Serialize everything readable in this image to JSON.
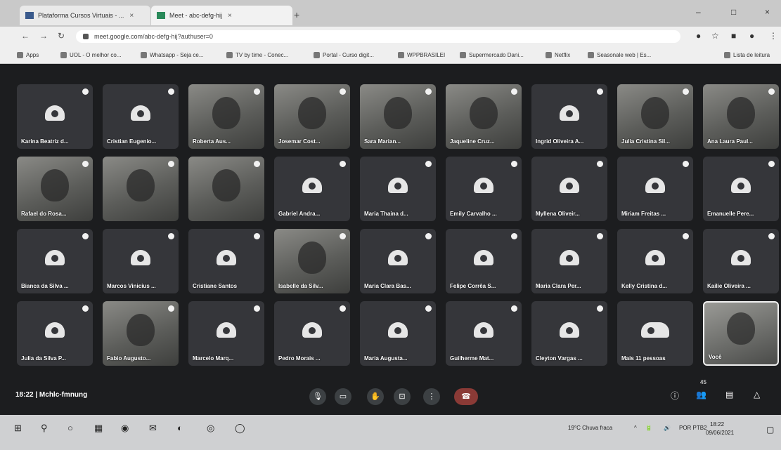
{
  "browser": {
    "tabs": [
      {
        "title": "Plataforma Cursos Virtuais - ...",
        "close": "×"
      },
      {
        "title": "Meet - abc-defg-hij",
        "close": "×"
      }
    ],
    "new_tab": "+",
    "window_controls": [
      "–",
      "□",
      "×"
    ],
    "nav": {
      "back": "←",
      "forward": "→",
      "reload": "↻"
    },
    "url": "meet.google.com/abc-defg-hij?authuser=0",
    "extensions": [
      "●",
      "☆",
      "■",
      "●",
      "⋮"
    ],
    "bookmarks": [
      "Apps",
      "UOL - O melhor co...",
      "Whatsapp - Seja ce...",
      "TV by time - Conec...",
      "Portal - Curso digit...",
      "WPPBRASILEI",
      "Supermercado Dani...",
      "Netflix",
      "Seasonale web | Es...",
      "Lista de leitura"
    ]
  },
  "meeting": {
    "participants": [
      {
        "name": "Karina Beatriz d...",
        "camera": false
      },
      {
        "name": "Cristian Eugenio...",
        "camera": false
      },
      {
        "name": "Roberta Aus...",
        "camera": true
      },
      {
        "name": "Josemar Cost...",
        "camera": true
      },
      {
        "name": "Sara Marian...",
        "camera": true
      },
      {
        "name": "Jaqueline Cruz...",
        "camera": true
      },
      {
        "name": "Ingrid Oliveira A...",
        "camera": false
      },
      {
        "name": "Julia Cristina Sil...",
        "camera": true
      },
      {
        "name": "Ana Laura Paul...",
        "camera": true
      },
      {
        "name": "Rafael do Rosa...",
        "camera": true
      },
      {
        "name": "",
        "camera": true
      },
      {
        "name": "",
        "camera": true
      },
      {
        "name": "Gabriel Andra...",
        "camera": false
      },
      {
        "name": "Maria Thaina d...",
        "camera": false
      },
      {
        "name": "Emily Carvalho ...",
        "camera": false
      },
      {
        "name": "Myllena Oliveir...",
        "camera": false
      },
      {
        "name": "Miriam Freitas ...",
        "camera": false
      },
      {
        "name": "Emanuelle Pere...",
        "camera": false
      },
      {
        "name": "Bianca da Silva ...",
        "camera": false
      },
      {
        "name": "Marcos Vinicius ...",
        "camera": false
      },
      {
        "name": "Cristiane Santos",
        "camera": false
      },
      {
        "name": "Isabelle da Silv...",
        "camera": true
      },
      {
        "name": "Maria Clara Bas...",
        "camera": false
      },
      {
        "name": "Felipe Corrêa S...",
        "camera": false
      },
      {
        "name": "Maria Clara Per...",
        "camera": false
      },
      {
        "name": "Kelly Cristina d...",
        "camera": false
      },
      {
        "name": "Kailie Oliveira ...",
        "camera": false
      },
      {
        "name": "Julia da Silva P...",
        "camera": false
      },
      {
        "name": "Fabio Augusto...",
        "camera": true
      },
      {
        "name": "Marcelo Marq...",
        "camera": false
      },
      {
        "name": "Pedro Morais ...",
        "camera": false
      },
      {
        "name": "Maria Augusta...",
        "camera": false
      },
      {
        "name": "Guilherme Mat...",
        "camera": false
      },
      {
        "name": "Cleyton Vargas ...",
        "camera": false
      }
    ],
    "others_tile": {
      "label": "Mais 11 pessoas"
    },
    "self_tile": {
      "label": "Você"
    },
    "clock_and_code": "18:22 | Mchlc-fmnung",
    "controls": {
      "mic": "🎙",
      "camera": "▭",
      "hand": "✋",
      "present": "⊡",
      "more": "⋮",
      "hangup": "☎"
    },
    "right_controls": {
      "info": "ⓘ",
      "people": "👥",
      "chat": "▤",
      "activities": "△",
      "people_count": "45"
    }
  },
  "taskbar": {
    "icons": [
      "⊞",
      "⚲",
      "○",
      "▦",
      "◉",
      "✉",
      "◐",
      "◎",
      "◯"
    ],
    "weather": "19°C Chuva fraca",
    "tray_icons": [
      "^",
      "🔋",
      "🔊"
    ],
    "lang": "POR PTB2",
    "time": "18:22",
    "date": "09/06/2021",
    "notification": "▢"
  }
}
